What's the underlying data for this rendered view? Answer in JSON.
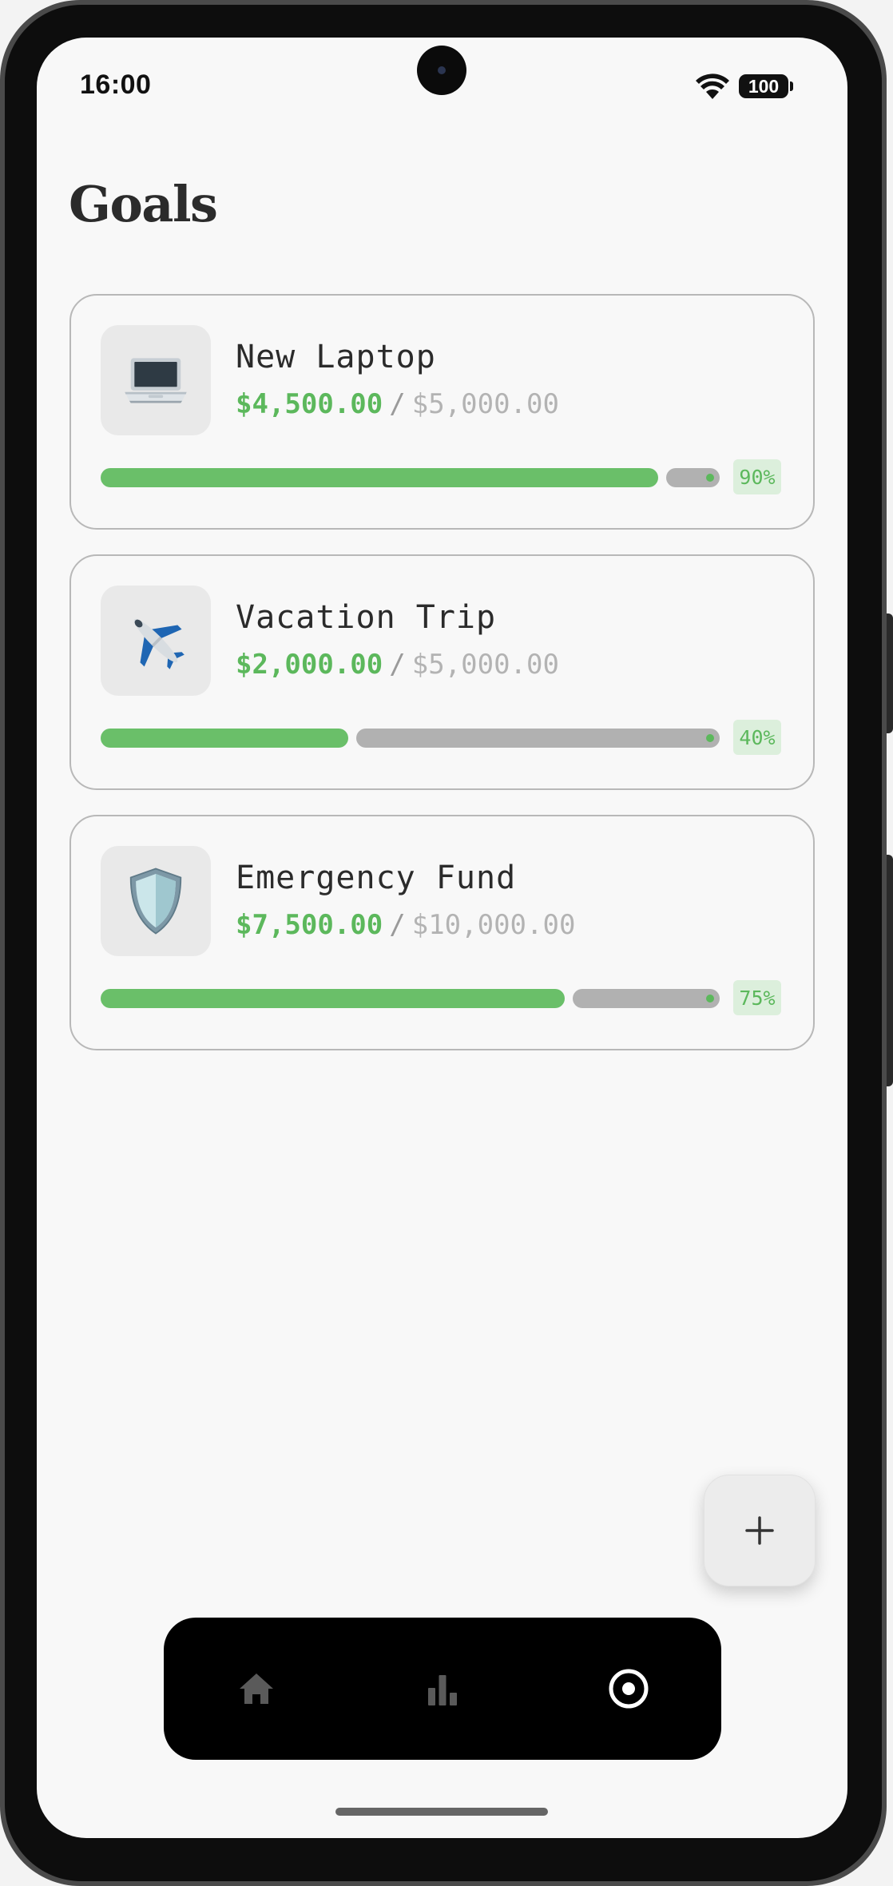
{
  "status_bar": {
    "time": "16:00",
    "battery": "100",
    "icons": [
      "wifi-icon",
      "battery-icon"
    ]
  },
  "page": {
    "title": "Goals"
  },
  "goals": [
    {
      "name": "New Laptop",
      "current": "$4,500.00",
      "separator": "/",
      "target": "$5,000.00",
      "percent_label": "90%",
      "progress": 0.9,
      "icon": "laptop-icon"
    },
    {
      "name": "Vacation Trip",
      "current": "$2,000.00",
      "separator": "/",
      "target": "$5,000.00",
      "percent_label": "40%",
      "progress": 0.4,
      "icon": "airplane-icon"
    },
    {
      "name": "Emergency Fund",
      "current": "$7,500.00",
      "separator": "/",
      "target": "$10,000.00",
      "percent_label": "75%",
      "progress": 0.75,
      "icon": "shield-icon"
    }
  ],
  "fab": {
    "icon": "plus-icon"
  },
  "nav": {
    "items": [
      {
        "icon": "home-icon",
        "active": false
      },
      {
        "icon": "bar-chart-icon",
        "active": false
      },
      {
        "icon": "target-icon",
        "active": true
      }
    ]
  },
  "colors": {
    "accent_green": "#5cb85c",
    "progress_fill": "#6abf69",
    "progress_track": "#b1b1b1",
    "percent_bg": "#dcefdc",
    "nav_background": "#000000",
    "nav_inactive": "#5a5a5a",
    "nav_active": "#ffffff",
    "screen_background": "#f8f8f8"
  }
}
